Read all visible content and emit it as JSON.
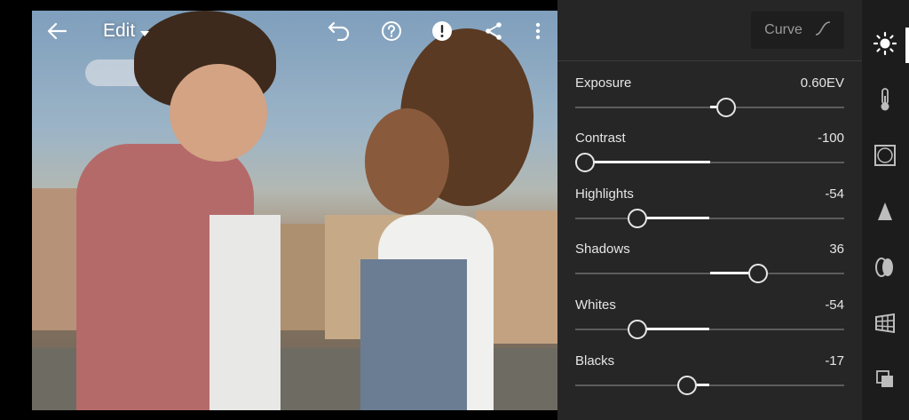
{
  "toolbar": {
    "back_icon": "arrow-left-icon",
    "edit_label": "Edit",
    "dropdown_icon": "caret-down-icon",
    "undo_icon": "undo-icon",
    "help_icon": "help-circle-icon",
    "alert_icon": "alert-circle-icon",
    "share_icon": "share-icon",
    "more_icon": "more-vertical-icon"
  },
  "panel": {
    "curve_label": "Curve",
    "curve_icon": "curve-icon",
    "sliders": [
      {
        "label": "Exposure",
        "value": "0.60EV",
        "position": 0.56
      },
      {
        "label": "Contrast",
        "value": "-100",
        "position": 0.0
      },
      {
        "label": "Highlights",
        "value": "-54",
        "position": 0.23
      },
      {
        "label": "Shadows",
        "value": "36",
        "position": 0.68
      },
      {
        "label": "Whites",
        "value": "-54",
        "position": 0.23
      },
      {
        "label": "Blacks",
        "value": "-17",
        "position": 0.415
      }
    ]
  },
  "rail": {
    "items": [
      {
        "icon": "light-sun-icon",
        "active": true
      },
      {
        "icon": "color-thermometer-icon",
        "active": false
      },
      {
        "icon": "effects-vignette-icon",
        "active": false
      },
      {
        "icon": "detail-triangle-icon",
        "active": false
      },
      {
        "icon": "optics-lens-icon",
        "active": false
      },
      {
        "icon": "geometry-grid-icon",
        "active": false
      },
      {
        "icon": "presets-stack-icon",
        "active": false
      }
    ]
  },
  "colors": {
    "panel_bg": "#262626",
    "rail_bg": "#1c1c1c",
    "accent": "#ffffff"
  }
}
